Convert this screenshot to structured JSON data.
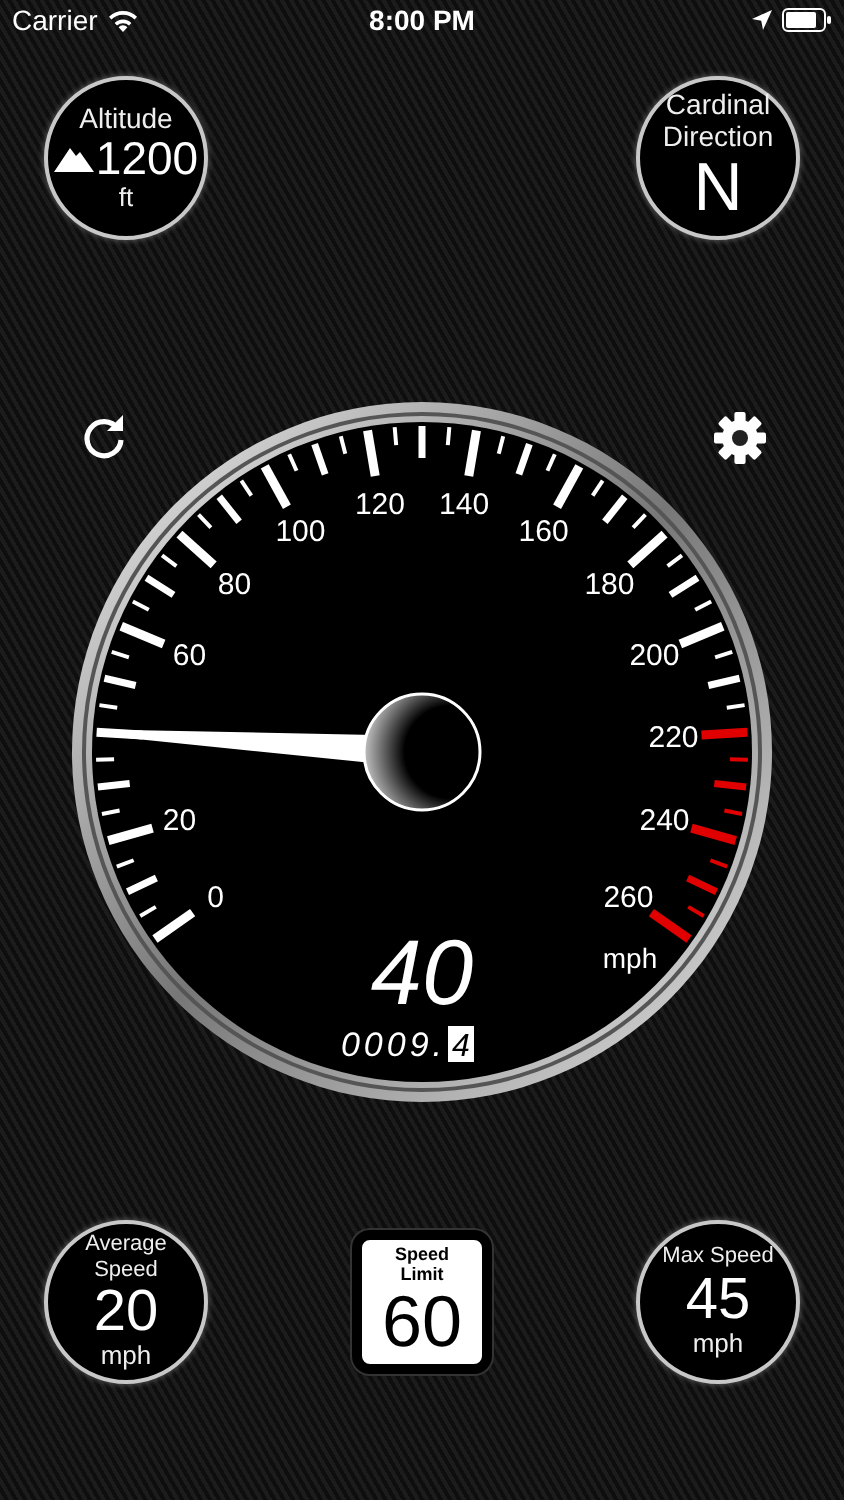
{
  "status_bar": {
    "carrier": "Carrier",
    "time": "8:00 PM"
  },
  "altitude": {
    "label": "Altitude",
    "value": "1200",
    "unit": "ft"
  },
  "direction": {
    "label": "Cardinal Direction",
    "value": "N"
  },
  "gauge": {
    "speed": "40",
    "unit": "mph",
    "odometer": "0009.",
    "odometer_tenth": "4",
    "labels": [
      "0",
      "20",
      "60",
      "80",
      "100",
      "120",
      "140",
      "160",
      "180",
      "200",
      "220",
      "240",
      "260"
    ]
  },
  "average": {
    "label": "Average Speed",
    "value": "20",
    "unit": "mph"
  },
  "speed_limit": {
    "label": "Speed Limit",
    "value": "60"
  },
  "max": {
    "label": "Max Speed",
    "value": "45",
    "unit": "mph"
  }
}
